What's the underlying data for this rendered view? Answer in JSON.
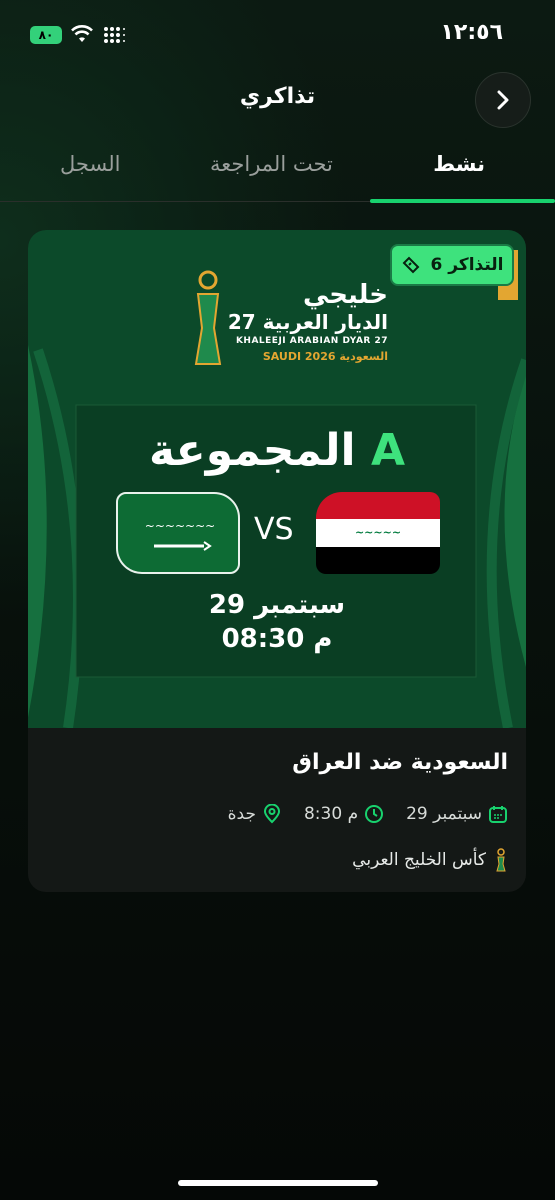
{
  "status_bar": {
    "battery": "٨٠",
    "time": "١٢:٥٦"
  },
  "header": {
    "title": "تذاكري"
  },
  "tabs": [
    {
      "label": "نشط",
      "active": true
    },
    {
      "label": "تحت المراجعة",
      "active": false
    },
    {
      "label": "السجل",
      "active": false
    }
  ],
  "ticket": {
    "badge": "6 التذاكر",
    "banner": {
      "logo_line1": "خليجي",
      "logo_line2": "الديار العربية 27",
      "logo_en": "KHALEEJI ARABIAN DYAR 27",
      "logo_saudi": "SAUDI 2026 السعودية",
      "group_word": "المجموعة",
      "group_letter": "A",
      "vs": "VS",
      "date": "29 سبتمبر",
      "time": "08:30 م"
    },
    "match_title": "السعودية ضد العراق",
    "date": "29 سبتمبر",
    "time": "8:30 م",
    "city": "جدة",
    "tournament": "كأس الخليج العربي"
  },
  "colors": {
    "accent": "#18d26e",
    "badge": "#3ee27d",
    "banner_bg": "#0c4a2a"
  }
}
